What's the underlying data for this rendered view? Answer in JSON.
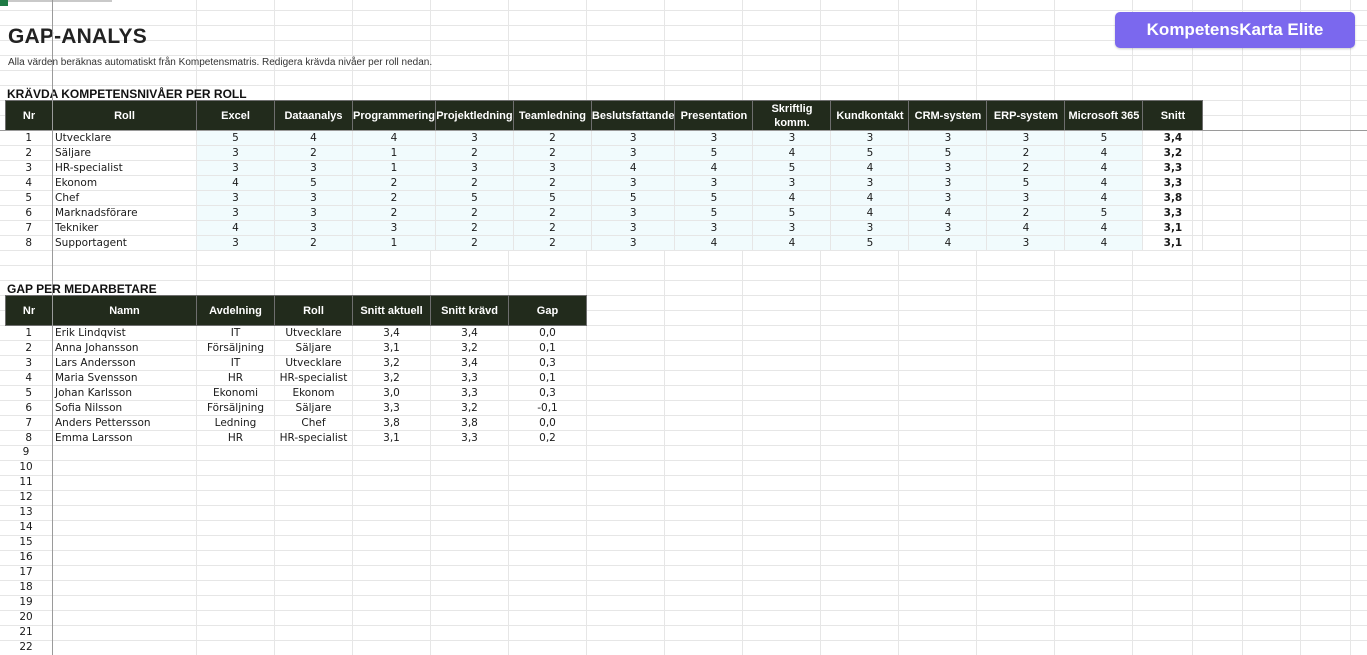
{
  "page": {
    "title": "GAP-ANALYS",
    "subtitle": "Alla värden beräknas automatiskt från Kompetensmatris. Redigera krävda nivåer per roll nedan."
  },
  "brand": {
    "label": "KompetensKarta Elite",
    "color": "#7b68ee"
  },
  "colors": {
    "header_bg": "#222b1c",
    "level_cell_bg": "#f1fbfd",
    "sheet_green": "#1f7a45"
  },
  "required_levels": {
    "title": "KRÄVDA KOMPETENSNIVÅER PER ROLL",
    "headers": [
      "Nr",
      "Roll",
      "Excel",
      "Dataanalys",
      "Programmering",
      "Projektledning",
      "Teamledning",
      "Beslutsfattande",
      "Presentation",
      "Skriftlig komm.",
      "Kundkontakt",
      "CRM-system",
      "ERP-system",
      "Microsoft 365",
      "Snitt"
    ],
    "rows": [
      [
        "1",
        "Utvecklare",
        "5",
        "4",
        "4",
        "3",
        "2",
        "3",
        "3",
        "3",
        "3",
        "3",
        "3",
        "5",
        "3,4"
      ],
      [
        "2",
        "Säljare",
        "3",
        "2",
        "1",
        "2",
        "2",
        "3",
        "5",
        "4",
        "5",
        "5",
        "2",
        "4",
        "3,2"
      ],
      [
        "3",
        "HR-specialist",
        "3",
        "3",
        "1",
        "3",
        "3",
        "4",
        "4",
        "5",
        "4",
        "3",
        "2",
        "4",
        "3,3"
      ],
      [
        "4",
        "Ekonom",
        "4",
        "5",
        "2",
        "2",
        "2",
        "3",
        "3",
        "3",
        "3",
        "3",
        "5",
        "4",
        "3,3"
      ],
      [
        "5",
        "Chef",
        "3",
        "3",
        "2",
        "5",
        "5",
        "5",
        "5",
        "4",
        "4",
        "3",
        "3",
        "4",
        "3,8"
      ],
      [
        "6",
        "Marknadsförare",
        "3",
        "3",
        "2",
        "2",
        "2",
        "3",
        "5",
        "5",
        "4",
        "4",
        "2",
        "5",
        "3,3"
      ],
      [
        "7",
        "Tekniker",
        "4",
        "3",
        "3",
        "2",
        "2",
        "3",
        "3",
        "3",
        "3",
        "3",
        "4",
        "4",
        "3,1"
      ],
      [
        "8",
        "Supportagent",
        "3",
        "2",
        "1",
        "2",
        "2",
        "3",
        "4",
        "4",
        "5",
        "4",
        "3",
        "4",
        "3,1"
      ]
    ]
  },
  "gap_per_employee": {
    "title": "GAP PER MEDARBETARE",
    "headers": [
      "Nr",
      "Namn",
      "Avdelning",
      "Roll",
      "Snitt aktuell",
      "Snitt krävd",
      "Gap"
    ],
    "rows": [
      [
        "1",
        "Erik Lindqvist",
        "IT",
        "Utvecklare",
        "3,4",
        "3,4",
        "0,0"
      ],
      [
        "2",
        "Anna Johansson",
        "Försäljning",
        "Säljare",
        "3,1",
        "3,2",
        "0,1"
      ],
      [
        "3",
        "Lars Andersson",
        "IT",
        "Utvecklare",
        "3,2",
        "3,4",
        "0,3"
      ],
      [
        "4",
        "Maria Svensson",
        "HR",
        "HR-specialist",
        "3,2",
        "3,3",
        "0,1"
      ],
      [
        "5",
        "Johan Karlsson",
        "Ekonomi",
        "Ekonom",
        "3,0",
        "3,3",
        "0,3"
      ],
      [
        "6",
        "Sofia Nilsson",
        "Försäljning",
        "Säljare",
        "3,3",
        "3,2",
        "-0,1"
      ],
      [
        "7",
        "Anders Pettersson",
        "Ledning",
        "Chef",
        "3,8",
        "3,8",
        "0,0"
      ],
      [
        "8",
        "Emma Larsson",
        "HR",
        "HR-specialist",
        "3,1",
        "3,3",
        "0,2"
      ]
    ],
    "empty_row_numbers": [
      "9",
      "10",
      "11",
      "12",
      "13",
      "14",
      "15",
      "16",
      "17",
      "18",
      "19",
      "20",
      "21",
      "22"
    ]
  }
}
